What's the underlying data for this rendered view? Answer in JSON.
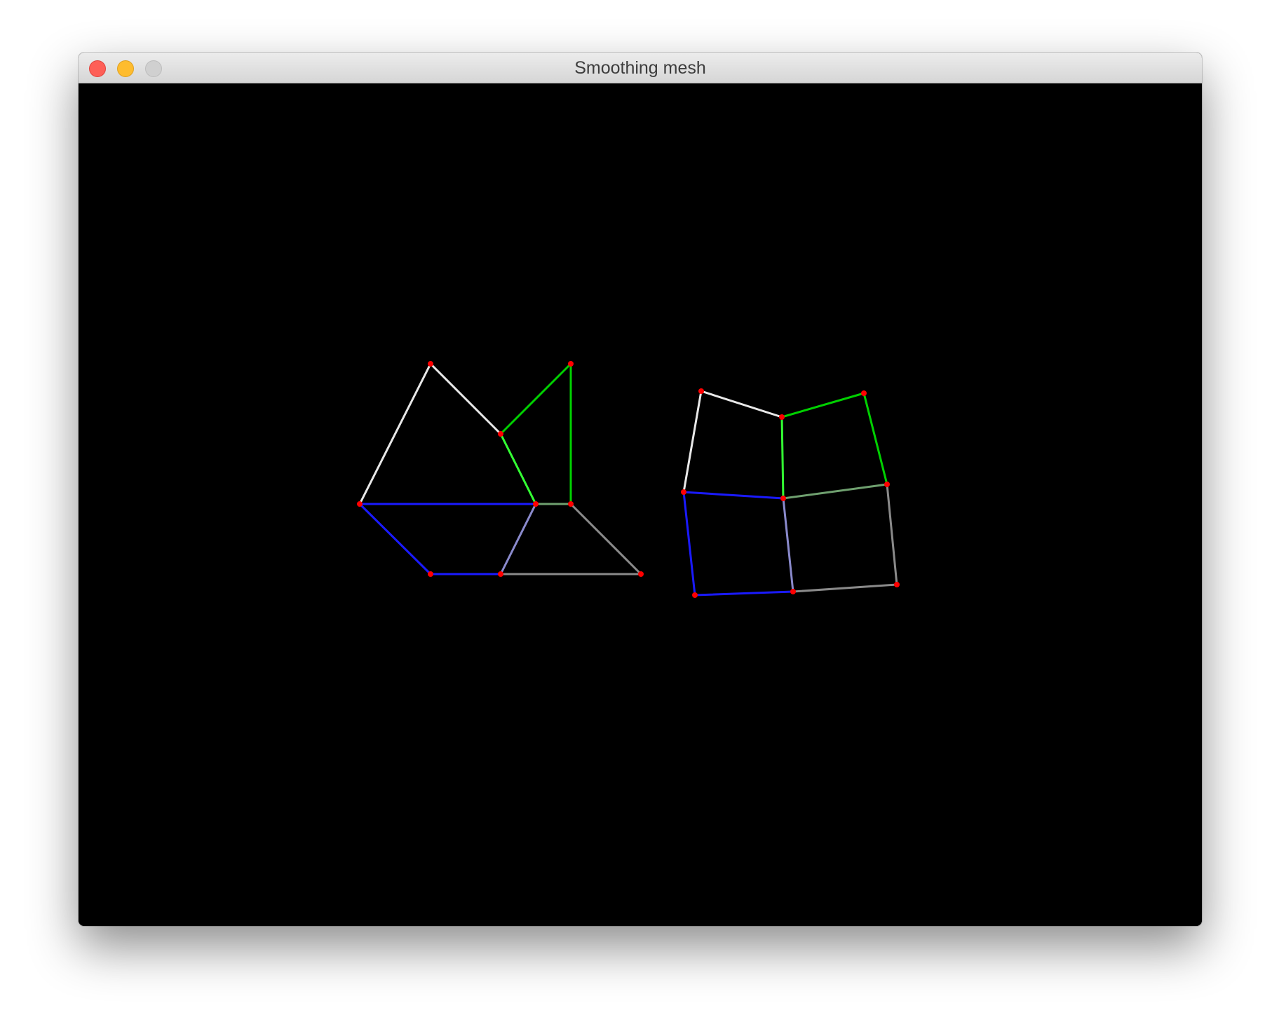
{
  "window": {
    "title": "Smoothing mesh",
    "buttons": {
      "close": "close-icon",
      "minimize": "minimize-icon",
      "zoom": "zoom-icon"
    }
  },
  "colors": {
    "canvas_background": "#000000",
    "vertex": "#ff0000",
    "edge_white": "#e8e8e8",
    "edge_green": "#00d000",
    "edge_bright_green": "#33ff33",
    "edge_blue": "#1a1aff",
    "edge_gray": "#8a8a8a",
    "edge_lavender": "#8a8acc",
    "edge_sage": "#6fa06f"
  }
}
